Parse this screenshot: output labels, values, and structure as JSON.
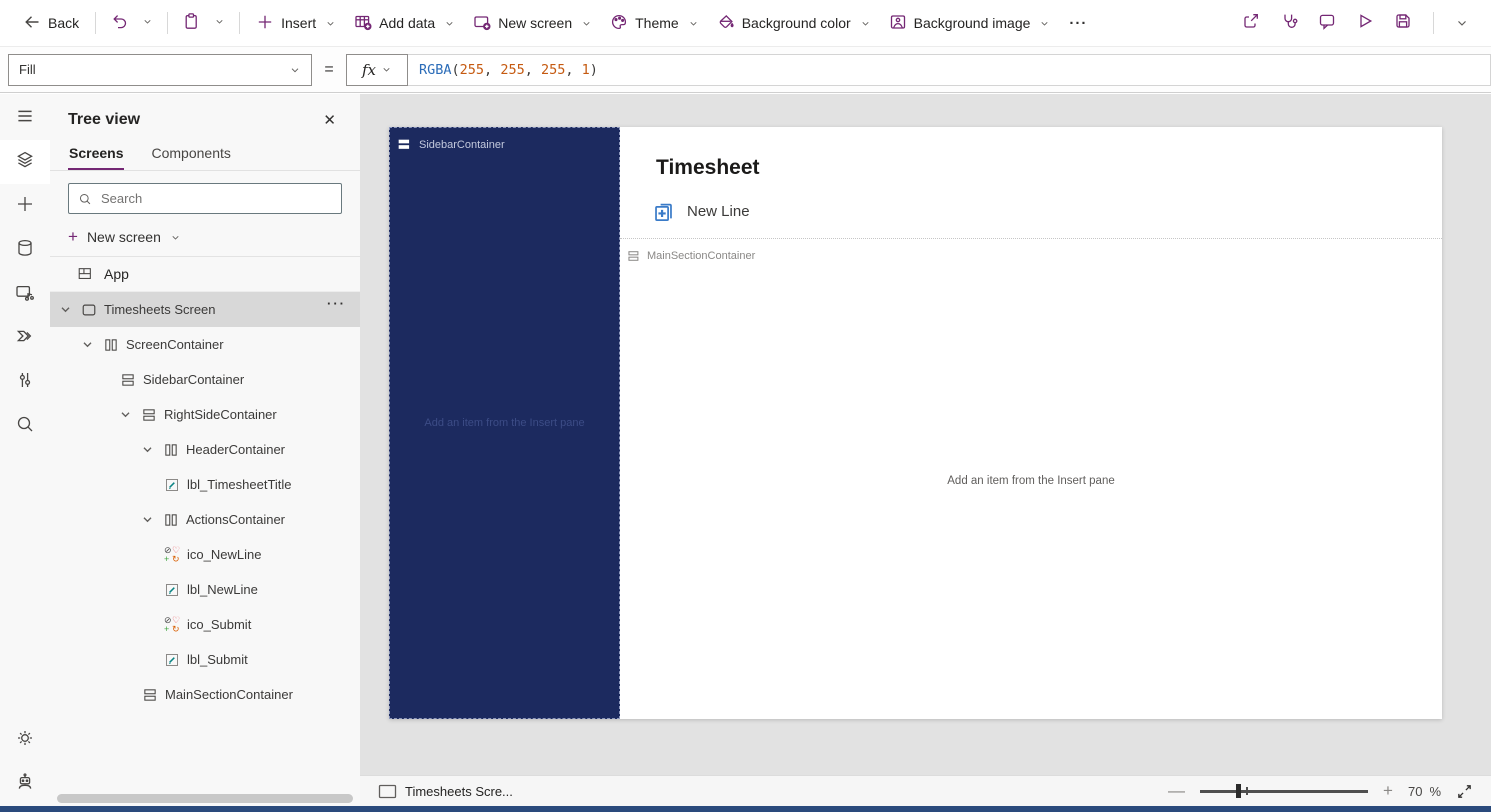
{
  "colors": {
    "accent": "#742774",
    "canvas_sidebar_navy": "#1c2a5f",
    "new_line_blue": "#3a7bc8",
    "label_icon_teal": "#0b8484",
    "formula_function_blue": "#2b6cb8",
    "formula_number_orange": "#c55a11",
    "taskbar_strip": "#2a4a7c"
  },
  "toolbar": {
    "back_label": "Back",
    "icon_buttons": [
      {
        "icon": "undo",
        "chevron": true
      },
      {
        "icon": "paste",
        "chevron": true
      }
    ],
    "items": [
      {
        "icon": "insert-plus",
        "label": "Insert",
        "chevron": true
      },
      {
        "icon": "add-data",
        "label": "Add data",
        "chevron": true
      },
      {
        "icon": "new-screen",
        "label": "New screen",
        "chevron": true
      },
      {
        "icon": "theme",
        "label": "Theme",
        "chevron": true
      },
      {
        "icon": "background-color",
        "label": "Background color",
        "chevron": true
      },
      {
        "icon": "background-image",
        "label": "Background image",
        "chevron": true
      }
    ],
    "more_label": "···",
    "right_icons": [
      "share",
      "app-checker",
      "comments",
      "preview-play",
      "save"
    ]
  },
  "formula_bar": {
    "property_selected": "Fill",
    "equals": "=",
    "fx_label": "fx",
    "tokens": [
      {
        "text": "RGBA",
        "type": "func"
      },
      {
        "text": "(",
        "type": "punct"
      },
      {
        "text": "255",
        "type": "num"
      },
      {
        "text": ", ",
        "type": "punct"
      },
      {
        "text": "255",
        "type": "num"
      },
      {
        "text": ", ",
        "type": "punct"
      },
      {
        "text": "255",
        "type": "num"
      },
      {
        "text": ", ",
        "type": "punct"
      },
      {
        "text": "1",
        "type": "num"
      },
      {
        "text": ")",
        "type": "punct"
      }
    ]
  },
  "rail": {
    "items": [
      {
        "name": "menu",
        "selected": false
      },
      {
        "name": "tree-view",
        "selected": true
      },
      {
        "name": "insert",
        "selected": false
      },
      {
        "name": "data",
        "selected": false
      },
      {
        "name": "media",
        "selected": false
      },
      {
        "name": "power-automate",
        "selected": false
      },
      {
        "name": "variables",
        "selected": false
      },
      {
        "name": "search",
        "selected": false
      }
    ],
    "bottom_items": [
      {
        "name": "settings",
        "selected": false
      },
      {
        "name": "copilot",
        "selected": false
      }
    ]
  },
  "panel": {
    "title": "Tree view",
    "close_glyph": "✕",
    "tabs": [
      {
        "label": "Screens",
        "active": true
      },
      {
        "label": "Components",
        "active": false
      }
    ],
    "search_placeholder": "Search",
    "new_screen_label": "New screen",
    "app_label": "App",
    "more_glyph": "···",
    "tree": [
      {
        "label": "Timesheets Screen",
        "icon": "screen",
        "level": 0,
        "chevron": true,
        "selected": true,
        "more": true
      },
      {
        "label": "ScreenContainer",
        "icon": "container-v",
        "level": 1,
        "chevron": true
      },
      {
        "label": "SidebarContainer",
        "icon": "container-h",
        "level": 2,
        "chevron": false
      },
      {
        "label": "RightSideContainer",
        "icon": "container-h",
        "level": 2,
        "chevron": true
      },
      {
        "label": "HeaderContainer",
        "icon": "container-v",
        "level": 3,
        "chevron": true
      },
      {
        "label": "lbl_TimesheetTitle",
        "icon": "label",
        "level": 4,
        "chevron": false
      },
      {
        "label": "ActionsContainer",
        "icon": "container-v",
        "level": 3,
        "chevron": true
      },
      {
        "label": "ico_NewLine",
        "icon": "icon-control",
        "level": 4,
        "chevron": false
      },
      {
        "label": "lbl_NewLine",
        "icon": "label",
        "level": 4,
        "chevron": false
      },
      {
        "label": "ico_Submit",
        "icon": "icon-control",
        "level": 4,
        "chevron": false
      },
      {
        "label": "lbl_Submit",
        "icon": "label",
        "level": 4,
        "chevron": false
      },
      {
        "label": "MainSectionContainer",
        "icon": "container-h",
        "level": 3,
        "chevron": false
      }
    ]
  },
  "canvas": {
    "sidebar_chip_label": "SidebarContainer",
    "sidebar_placeholder": "Add an item from the Insert pane",
    "header_title": "Timesheet",
    "new_line_label": "New Line",
    "main_section_chip_label": "MainSectionContainer",
    "main_placeholder": "Add an item from the Insert pane"
  },
  "bottom_bar": {
    "screen_label": "Timesheets Scre...",
    "zoom_minus": "—",
    "zoom_plus": "+",
    "zoom_value": "70",
    "zoom_percent": "%"
  }
}
